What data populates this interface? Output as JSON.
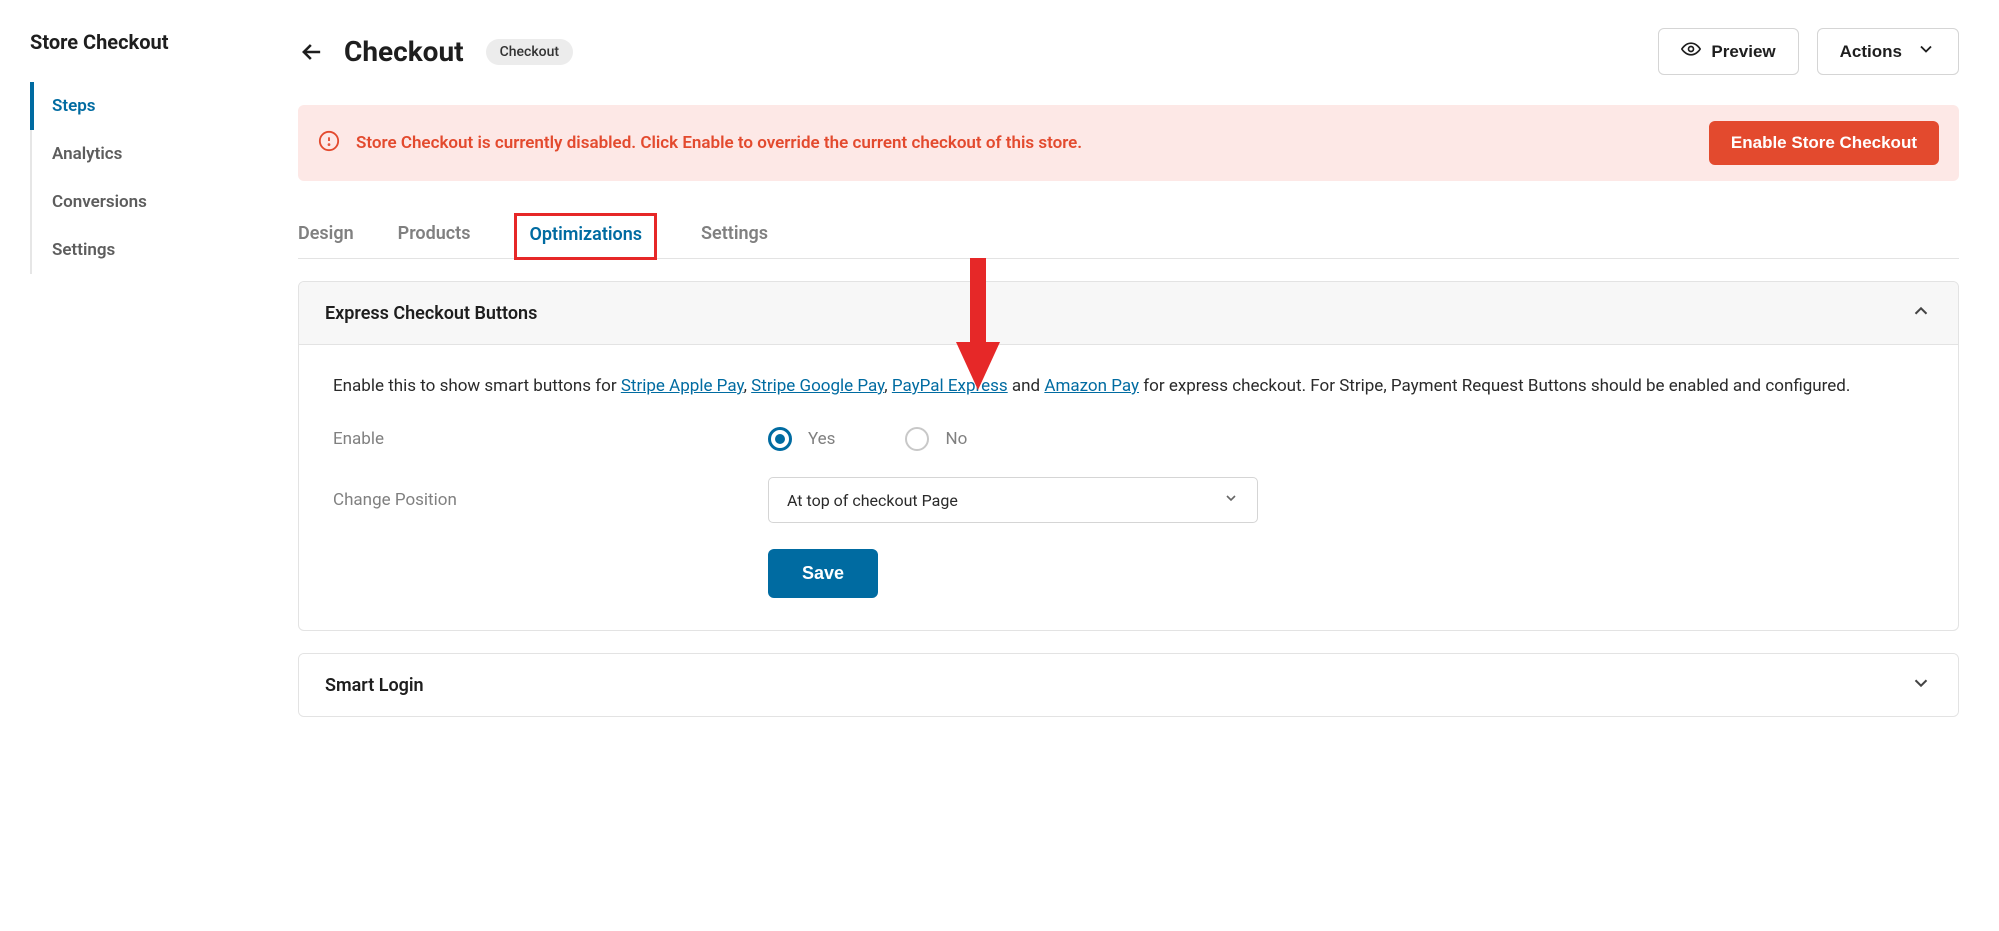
{
  "sidebar": {
    "title": "Store Checkout",
    "items": [
      {
        "label": "Steps",
        "active": true
      },
      {
        "label": "Analytics"
      },
      {
        "label": "Conversions"
      },
      {
        "label": "Settings"
      }
    ]
  },
  "header": {
    "title": "Checkout",
    "badge": "Checkout",
    "preview_label": "Preview",
    "actions_label": "Actions"
  },
  "alert": {
    "text": "Store Checkout is currently disabled. Click Enable to override the current checkout of this store.",
    "button": "Enable Store Checkout"
  },
  "tabs": [
    {
      "label": "Design"
    },
    {
      "label": "Products"
    },
    {
      "label": "Optimizations",
      "active": true
    },
    {
      "label": "Settings"
    }
  ],
  "express": {
    "title": "Express Checkout Buttons",
    "desc_pre": "Enable this to show smart buttons for ",
    "link1": "Stripe Apple Pay",
    "sep1": ", ",
    "link2": "Stripe Google Pay",
    "sep2": ", ",
    "link3": "PayPal Express",
    "sep3": " and ",
    "link4": "Amazon Pay",
    "desc_post": " for express checkout. For Stripe, Payment Request Buttons should be enabled and configured.",
    "enable_label": "Enable",
    "radio_yes": "Yes",
    "radio_no": "No",
    "enable_value": "yes",
    "position_label": "Change Position",
    "position_value": "At top of checkout Page",
    "save_label": "Save"
  },
  "smart_login": {
    "title": "Smart Login"
  }
}
